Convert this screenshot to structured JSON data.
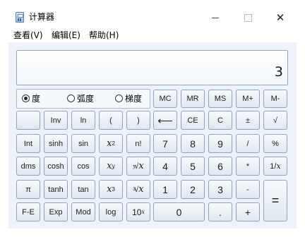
{
  "window": {
    "title": "计算器",
    "icon": "calculator-icon",
    "min_icon": "minimize-icon",
    "max_icon": "maximize-icon",
    "close_icon": "close-icon",
    "close_glyph": "✕"
  },
  "menu": [
    {
      "label": "查看(V)"
    },
    {
      "label": "编辑(E)"
    },
    {
      "label": "帮助(H)"
    }
  ],
  "display": {
    "value": "3"
  },
  "angle_units": {
    "options": [
      {
        "label": "度"
      },
      {
        "label": "弧度"
      },
      {
        "label": "梯度"
      }
    ],
    "selected": "度"
  },
  "memory": {
    "mc": "MC",
    "mr": "MR",
    "ms": "MS",
    "mplus": "M+",
    "mminus": "M-"
  },
  "keys": {
    "inv": "Inv",
    "ln": "ln",
    "lparen": "(",
    "rparen": ")",
    "backspace": "⟵",
    "ce": "CE",
    "c": "C",
    "plusminus": "±",
    "sqrt": "√",
    "int": "Int",
    "sinh": "sinh",
    "sin": "sin",
    "x": "x",
    "sq_exp": "2",
    "factorial": "n!",
    "d7": "7",
    "d8": "8",
    "d9": "9",
    "divide": "/",
    "percent": "%",
    "dms": "dms",
    "cosh": "cosh",
    "cos": "cos",
    "pow_exp": "y",
    "yroot_pre": "y",
    "root": "√",
    "d4": "4",
    "d5": "5",
    "d6": "6",
    "multiply": "*",
    "reciprocal_num": "1/",
    "reciprocal_var": "x",
    "pi": "π",
    "tanh": "tanh",
    "tan": "tan",
    "cube_exp": "3",
    "cbrt_pre": "3",
    "d1": "1",
    "d2": "2",
    "d3": "3",
    "minus": "-",
    "equals": "=",
    "fe": "F-E",
    "exp": "Exp",
    "mod": "Mod",
    "log": "log",
    "ten": "10",
    "ten_exp": "x",
    "d0": "0",
    "decimal": ".",
    "plus": "+"
  }
}
